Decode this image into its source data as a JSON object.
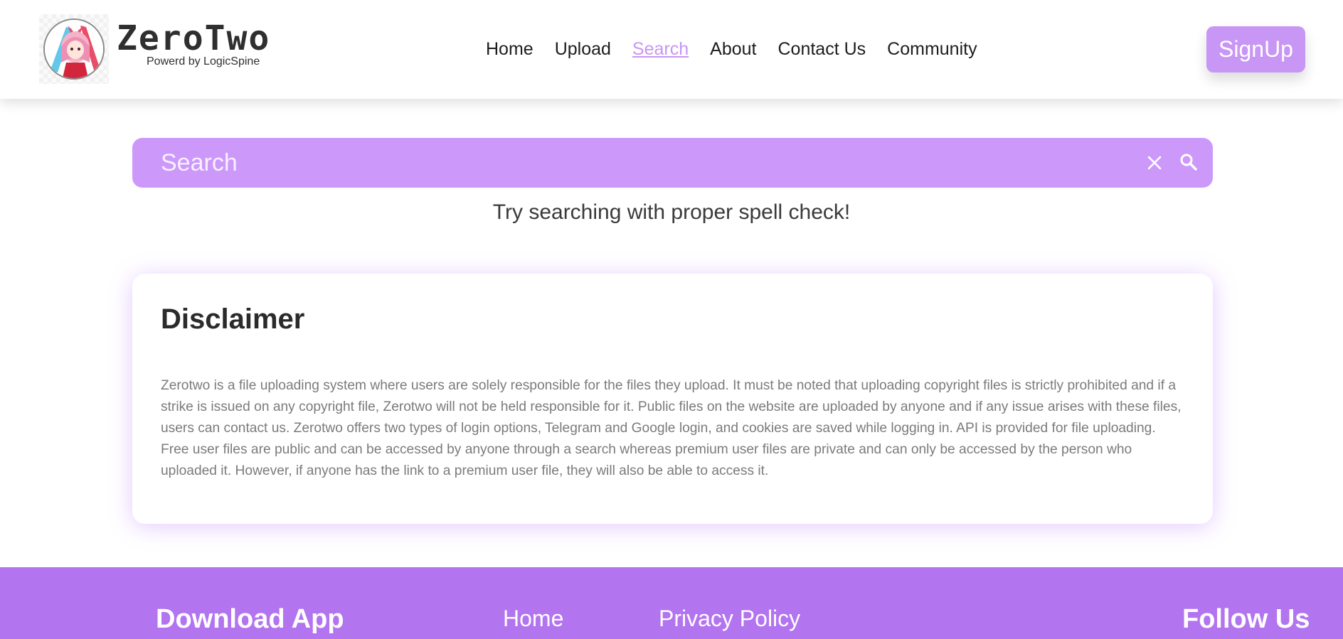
{
  "brand": {
    "title": "ZeroTwo",
    "subtitle": "Powerd by LogicSpine"
  },
  "nav": {
    "items": [
      {
        "label": "Home"
      },
      {
        "label": "Upload"
      },
      {
        "label": "Search",
        "active": true
      },
      {
        "label": "About"
      },
      {
        "label": "Contact Us"
      },
      {
        "label": "Community"
      }
    ]
  },
  "header": {
    "signup_label": "SignUp"
  },
  "search": {
    "placeholder": "Search",
    "value": "",
    "hint": "Try searching with proper spell check!"
  },
  "disclaimer": {
    "title": "Disclaimer",
    "body": "Zerotwo is a file uploading system where users are solely responsible for the files they upload. It must be noted that uploading copyright files is strictly prohibited and if a strike is issued on any copyright file, Zerotwo will not be held responsible for it. Public files on the website are uploaded by anyone and if any issue arises with these files, users can contact us. Zerotwo offers two types of login options, Telegram and Google login, and cookies are saved while logging in. API is provided for file uploading. Free user files are public and can be accessed by anyone through a search whereas premium user files are private and can only be accessed by the person who uploaded it. However, if anyone has the link to a premium user file, they will also be able to access it."
  },
  "footer": {
    "download_title": "Download App",
    "links": [
      {
        "label": "Home"
      },
      {
        "label": "Privacy Policy"
      }
    ],
    "follow_title": "Follow Us"
  },
  "colors": {
    "accent": "#cc99fa",
    "footer": "#b274ef",
    "active_nav": "#c995f2"
  },
  "icons": {
    "logo": "anime-avatar-logo",
    "clear": "close-icon",
    "search": "search-icon"
  }
}
